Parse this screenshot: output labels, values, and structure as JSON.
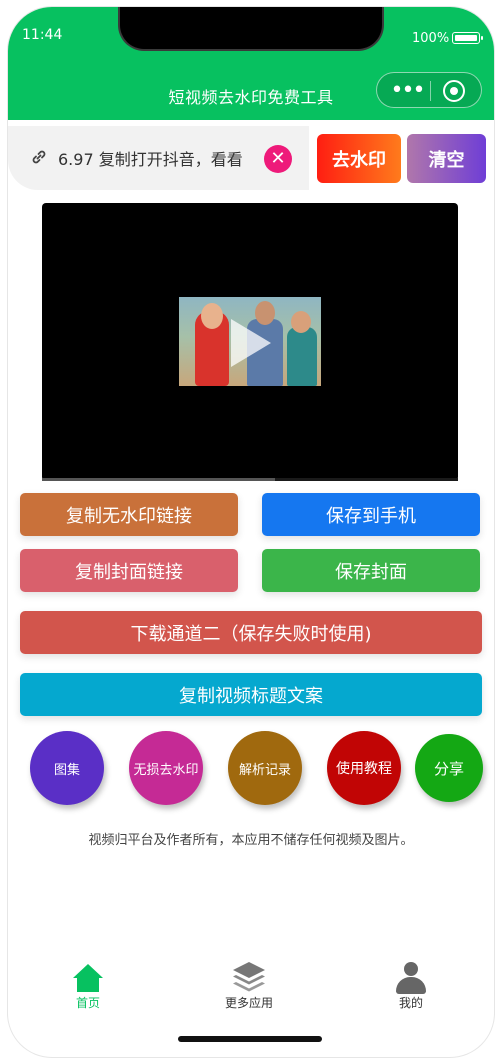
{
  "status_bar": {
    "time": "11:44",
    "battery_text": "100%",
    "battery_level": 1.0
  },
  "nav": {
    "title": "短视频去水印免费工具",
    "more_icon": "more-dots-icon",
    "close_icon": "target-circle-icon"
  },
  "input": {
    "value": "6.97 复制打开抖音，看看",
    "link_icon": "link-icon",
    "clear_icon": "clear-x-icon"
  },
  "actions": {
    "remove_watermark": "去水印",
    "clear": "清空"
  },
  "video": {
    "progress": 0.56,
    "play_icon": "play-icon"
  },
  "buttons": {
    "copy_link": "复制无水印链接",
    "save_phone": "保存到手机",
    "copy_cover": "复制封面链接",
    "save_cover": "保存封面",
    "download_alt": "下载通道二（保存失败时使用)",
    "copy_title": "复制视频标题文案"
  },
  "circles": {
    "gallery": "图集",
    "lossless": "无损去水印",
    "history": "解析记录",
    "tutorial": "使用教程",
    "share": "分享"
  },
  "disclaimer": "视频归平台及作者所有，本应用不储存任何视频及图片。",
  "tabs": [
    {
      "label": "首页",
      "icon": "home-icon",
      "active": true
    },
    {
      "label": "更多应用",
      "icon": "layers-icon",
      "active": false
    },
    {
      "label": "我的",
      "icon": "user-icon",
      "active": false
    }
  ],
  "colors": {
    "brand_green": "#07c160",
    "clear_pink": "#ee1a7a"
  }
}
